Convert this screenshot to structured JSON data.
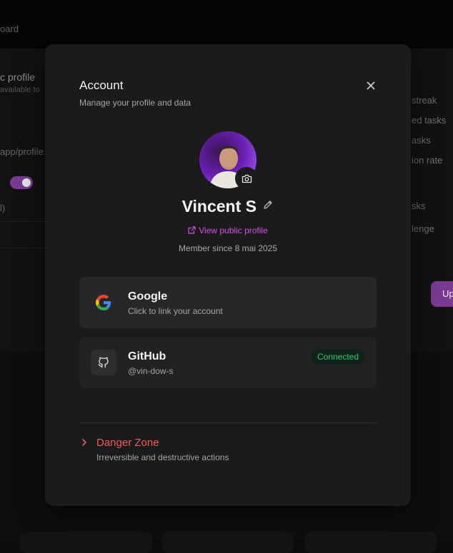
{
  "background": {
    "breadcrumb": "oard",
    "left": {
      "title": "c profile",
      "subtitle": "available to",
      "url": "app/profile",
      "note": "l)"
    },
    "right_items": [
      "streak",
      "ed tasks",
      "asks",
      "ion rate",
      "sks",
      "lenge"
    ],
    "upgrade_label": "Up"
  },
  "modal": {
    "title": "Account",
    "subtitle": "Manage your profile and data",
    "close_icon": "close-icon"
  },
  "profile": {
    "name": "Vincent S",
    "view_public_label": "View public profile",
    "member_since": "Member since 8 mai 2025",
    "avatar_accent": "#6d1fb0"
  },
  "accounts": [
    {
      "provider": "Google",
      "description": "Click to link your account",
      "icon": "google-icon",
      "status": ""
    },
    {
      "provider": "GitHub",
      "description": "@vin-dow-s",
      "icon": "github-icon",
      "status": "Connected"
    }
  ],
  "danger_zone": {
    "title": "Danger Zone",
    "description": "Irreversible and destructive actions"
  },
  "colors": {
    "accent": "#d84be8",
    "danger": "#ef5a5a",
    "success": "#2ec66e",
    "modal_bg": "#1b1b1b"
  }
}
